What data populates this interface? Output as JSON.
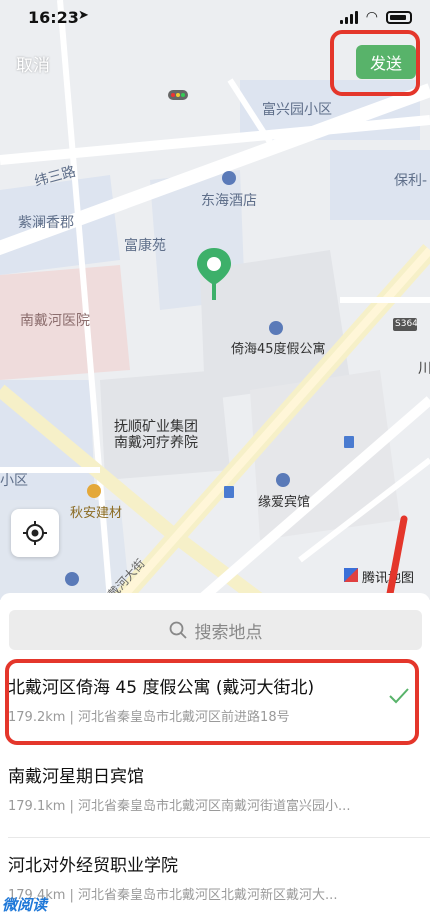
{
  "status": {
    "time": "16:23"
  },
  "header": {
    "cancel_label": "取消",
    "send_label": "发送"
  },
  "map": {
    "labels": {
      "fuxingyuan": "富兴园小区",
      "weisanlu": "纬三路",
      "donghai": "东海酒店",
      "baoli": "保利-",
      "zilan": "紫澜香郡",
      "fukang": "富康苑",
      "nandaihe_hospital": "南戴河医院",
      "yihai": "倚海45度假公寓",
      "s364": "S364",
      "fushun_1": "抚顺矿业集团",
      "fushun_2": "南戴河疗养院",
      "xiaoqu": "小区",
      "yuanai": "缘爱宾馆",
      "qiuan": "秋安建材",
      "daihe_street": "戴河大街",
      "chuan": "川",
      "logo_text": "腾讯地图"
    }
  },
  "sheet": {
    "search_placeholder": "搜索地点",
    "results": [
      {
        "name": "北戴河区倚海 45 度假公寓 (戴河大街北)",
        "addr": "179.2km | 河北省秦皇岛市北戴河区前进路18号",
        "selected": true
      },
      {
        "name": "南戴河星期日宾馆",
        "addr": "179.1km | 河北省秦皇岛市北戴河区南戴河街道富兴园小...",
        "selected": false
      },
      {
        "name": "河北对外经贸职业学院",
        "addr": "179.4km | 河北省秦皇岛市北戴河区北戴河新区戴河大...",
        "selected": false
      }
    ]
  },
  "watermark": "微阅读",
  "colors": {
    "accent_green": "#58b36a",
    "highlight_red": "#e4362b",
    "pin_green": "#3db06a"
  }
}
